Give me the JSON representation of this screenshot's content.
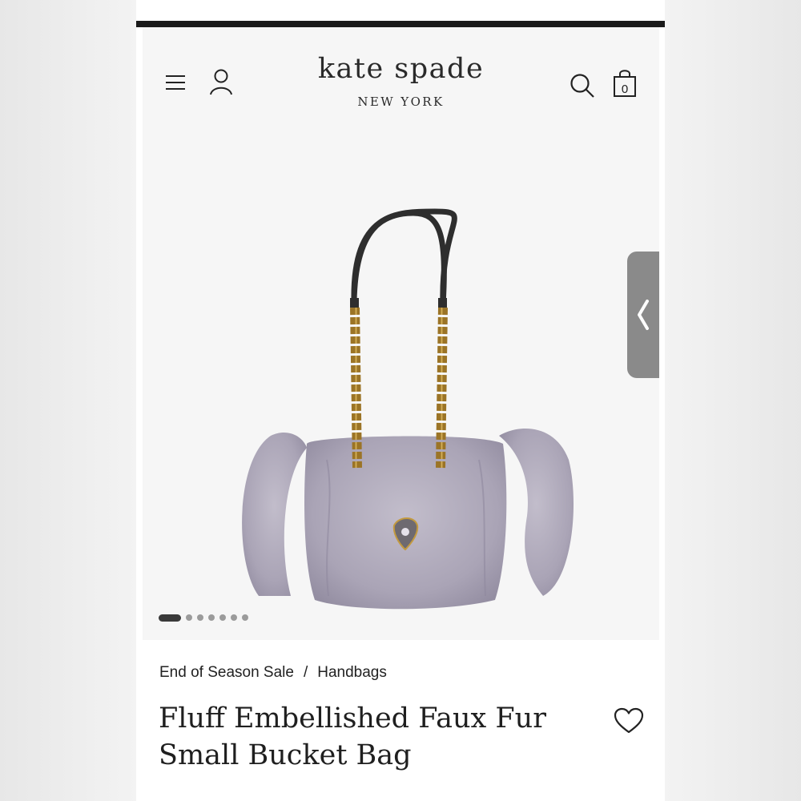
{
  "header": {
    "logo_main": "kate spade",
    "logo_sub": "NEW YORK",
    "menu_icon": "hamburger-menu-icon",
    "account_icon": "user-account-icon",
    "search_icon": "search-icon",
    "bag_icon": "shopping-bag-icon",
    "bag_count": "0"
  },
  "carousel": {
    "current_index": 1,
    "total": 7
  },
  "breadcrumb": {
    "items": [
      "End of Season Sale",
      "Handbags"
    ],
    "separator": "/"
  },
  "product": {
    "title_line1": "Fluff Embellished Faux Fur",
    "title_line2": "Small Bucket Bag",
    "wishlist_icon": "heart-icon"
  },
  "colors": {
    "fur": "#b3adbd",
    "hardware": "#c39a3f",
    "strap": "#2e2e2e",
    "text": "#222222"
  }
}
